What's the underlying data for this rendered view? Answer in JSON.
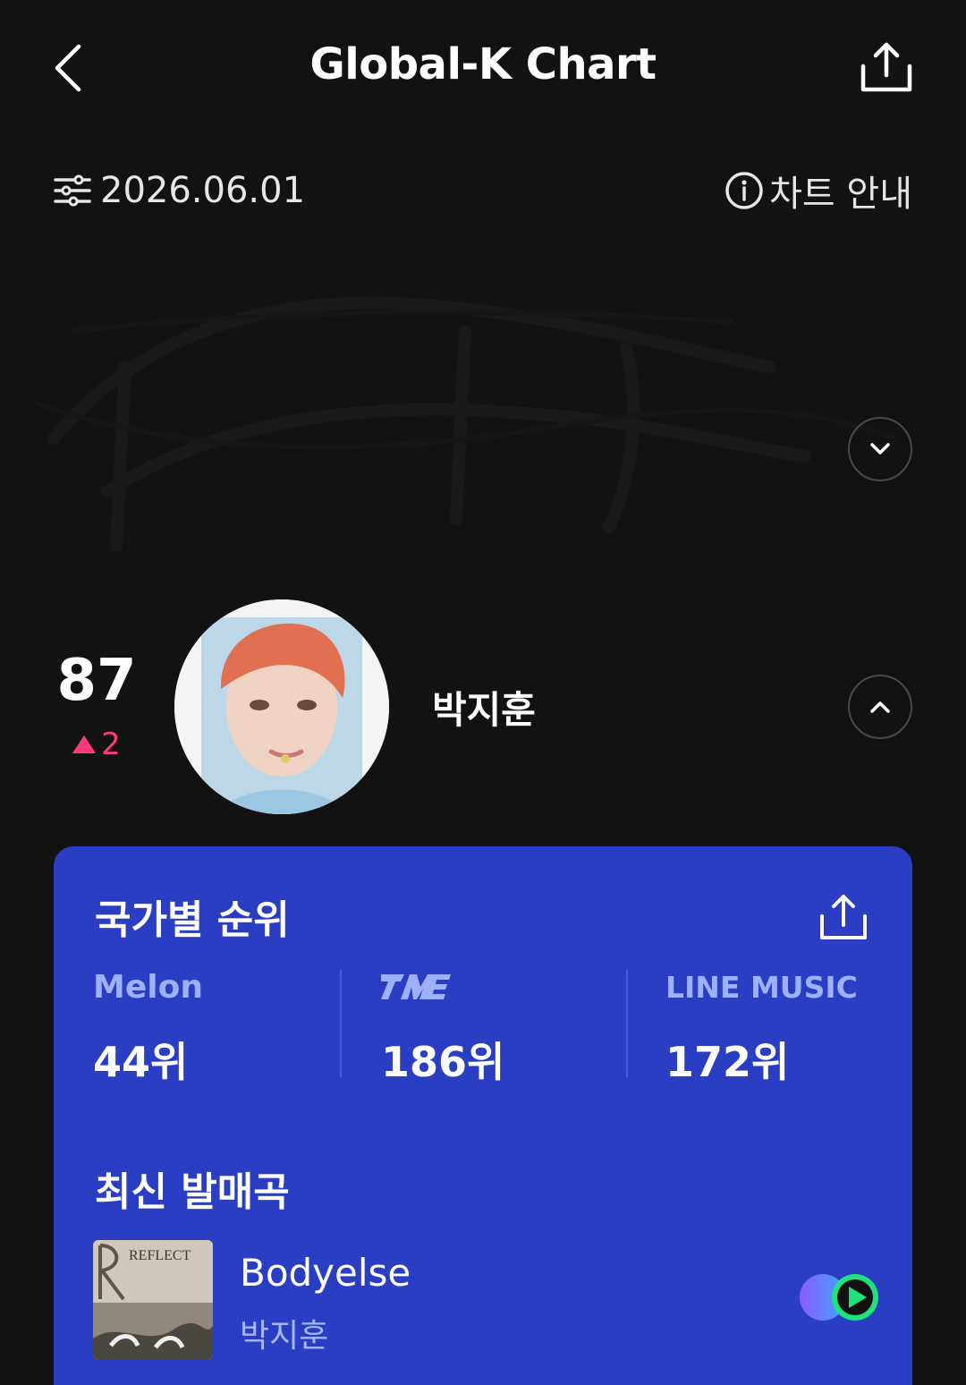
{
  "header": {
    "title": "Global-K Chart",
    "back_icon": "chevron-left-icon",
    "share_icon": "share-icon"
  },
  "toolbar": {
    "date": "2026.06.01",
    "date_icon": "filter-icon",
    "info_label": "차트 안내",
    "info_icon": "info-icon"
  },
  "entry": {
    "rank": "87",
    "change": "2",
    "change_direction": "up",
    "artist": "박지훈"
  },
  "card": {
    "title": "국가별 순위",
    "background": "#2a3ec3",
    "platforms": [
      {
        "name": "Melon",
        "rank": "44위"
      },
      {
        "name": "TME",
        "rank": "186위"
      },
      {
        "name": "LINE MUSIC",
        "rank": "172위"
      }
    ],
    "latest_title": "최신 발매곡",
    "latest_song": {
      "title": "Bodyelse",
      "artist": "박지훈",
      "cover_text": "REFLECT"
    }
  },
  "colors": {
    "background": "#121212",
    "accent_up": "#ff3b78",
    "logo_tint": "#9fb0ff"
  }
}
